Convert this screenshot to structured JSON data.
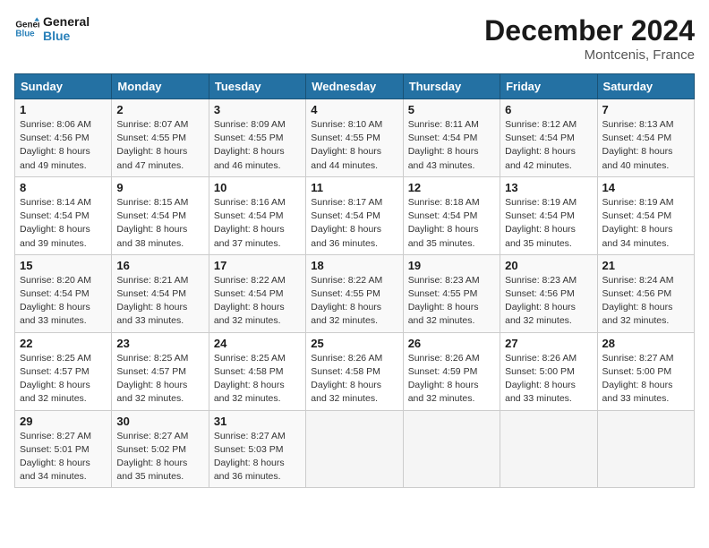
{
  "logo": {
    "line1": "General",
    "line2": "Blue"
  },
  "title": "December 2024",
  "subtitle": "Montcenis, France",
  "days_of_week": [
    "Sunday",
    "Monday",
    "Tuesday",
    "Wednesday",
    "Thursday",
    "Friday",
    "Saturday"
  ],
  "weeks": [
    [
      {
        "day": "1",
        "detail": "Sunrise: 8:06 AM\nSunset: 4:56 PM\nDaylight: 8 hours and 49 minutes."
      },
      {
        "day": "2",
        "detail": "Sunrise: 8:07 AM\nSunset: 4:55 PM\nDaylight: 8 hours and 47 minutes."
      },
      {
        "day": "3",
        "detail": "Sunrise: 8:09 AM\nSunset: 4:55 PM\nDaylight: 8 hours and 46 minutes."
      },
      {
        "day": "4",
        "detail": "Sunrise: 8:10 AM\nSunset: 4:55 PM\nDaylight: 8 hours and 44 minutes."
      },
      {
        "day": "5",
        "detail": "Sunrise: 8:11 AM\nSunset: 4:54 PM\nDaylight: 8 hours and 43 minutes."
      },
      {
        "day": "6",
        "detail": "Sunrise: 8:12 AM\nSunset: 4:54 PM\nDaylight: 8 hours and 42 minutes."
      },
      {
        "day": "7",
        "detail": "Sunrise: 8:13 AM\nSunset: 4:54 PM\nDaylight: 8 hours and 40 minutes."
      }
    ],
    [
      {
        "day": "8",
        "detail": "Sunrise: 8:14 AM\nSunset: 4:54 PM\nDaylight: 8 hours and 39 minutes."
      },
      {
        "day": "9",
        "detail": "Sunrise: 8:15 AM\nSunset: 4:54 PM\nDaylight: 8 hours and 38 minutes."
      },
      {
        "day": "10",
        "detail": "Sunrise: 8:16 AM\nSunset: 4:54 PM\nDaylight: 8 hours and 37 minutes."
      },
      {
        "day": "11",
        "detail": "Sunrise: 8:17 AM\nSunset: 4:54 PM\nDaylight: 8 hours and 36 minutes."
      },
      {
        "day": "12",
        "detail": "Sunrise: 8:18 AM\nSunset: 4:54 PM\nDaylight: 8 hours and 35 minutes."
      },
      {
        "day": "13",
        "detail": "Sunrise: 8:19 AM\nSunset: 4:54 PM\nDaylight: 8 hours and 35 minutes."
      },
      {
        "day": "14",
        "detail": "Sunrise: 8:19 AM\nSunset: 4:54 PM\nDaylight: 8 hours and 34 minutes."
      }
    ],
    [
      {
        "day": "15",
        "detail": "Sunrise: 8:20 AM\nSunset: 4:54 PM\nDaylight: 8 hours and 33 minutes."
      },
      {
        "day": "16",
        "detail": "Sunrise: 8:21 AM\nSunset: 4:54 PM\nDaylight: 8 hours and 33 minutes."
      },
      {
        "day": "17",
        "detail": "Sunrise: 8:22 AM\nSunset: 4:54 PM\nDaylight: 8 hours and 32 minutes."
      },
      {
        "day": "18",
        "detail": "Sunrise: 8:22 AM\nSunset: 4:55 PM\nDaylight: 8 hours and 32 minutes."
      },
      {
        "day": "19",
        "detail": "Sunrise: 8:23 AM\nSunset: 4:55 PM\nDaylight: 8 hours and 32 minutes."
      },
      {
        "day": "20",
        "detail": "Sunrise: 8:23 AM\nSunset: 4:56 PM\nDaylight: 8 hours and 32 minutes."
      },
      {
        "day": "21",
        "detail": "Sunrise: 8:24 AM\nSunset: 4:56 PM\nDaylight: 8 hours and 32 minutes."
      }
    ],
    [
      {
        "day": "22",
        "detail": "Sunrise: 8:25 AM\nSunset: 4:57 PM\nDaylight: 8 hours and 32 minutes."
      },
      {
        "day": "23",
        "detail": "Sunrise: 8:25 AM\nSunset: 4:57 PM\nDaylight: 8 hours and 32 minutes."
      },
      {
        "day": "24",
        "detail": "Sunrise: 8:25 AM\nSunset: 4:58 PM\nDaylight: 8 hours and 32 minutes."
      },
      {
        "day": "25",
        "detail": "Sunrise: 8:26 AM\nSunset: 4:58 PM\nDaylight: 8 hours and 32 minutes."
      },
      {
        "day": "26",
        "detail": "Sunrise: 8:26 AM\nSunset: 4:59 PM\nDaylight: 8 hours and 32 minutes."
      },
      {
        "day": "27",
        "detail": "Sunrise: 8:26 AM\nSunset: 5:00 PM\nDaylight: 8 hours and 33 minutes."
      },
      {
        "day": "28",
        "detail": "Sunrise: 8:27 AM\nSunset: 5:00 PM\nDaylight: 8 hours and 33 minutes."
      }
    ],
    [
      {
        "day": "29",
        "detail": "Sunrise: 8:27 AM\nSunset: 5:01 PM\nDaylight: 8 hours and 34 minutes."
      },
      {
        "day": "30",
        "detail": "Sunrise: 8:27 AM\nSunset: 5:02 PM\nDaylight: 8 hours and 35 minutes."
      },
      {
        "day": "31",
        "detail": "Sunrise: 8:27 AM\nSunset: 5:03 PM\nDaylight: 8 hours and 36 minutes."
      },
      null,
      null,
      null,
      null
    ]
  ]
}
